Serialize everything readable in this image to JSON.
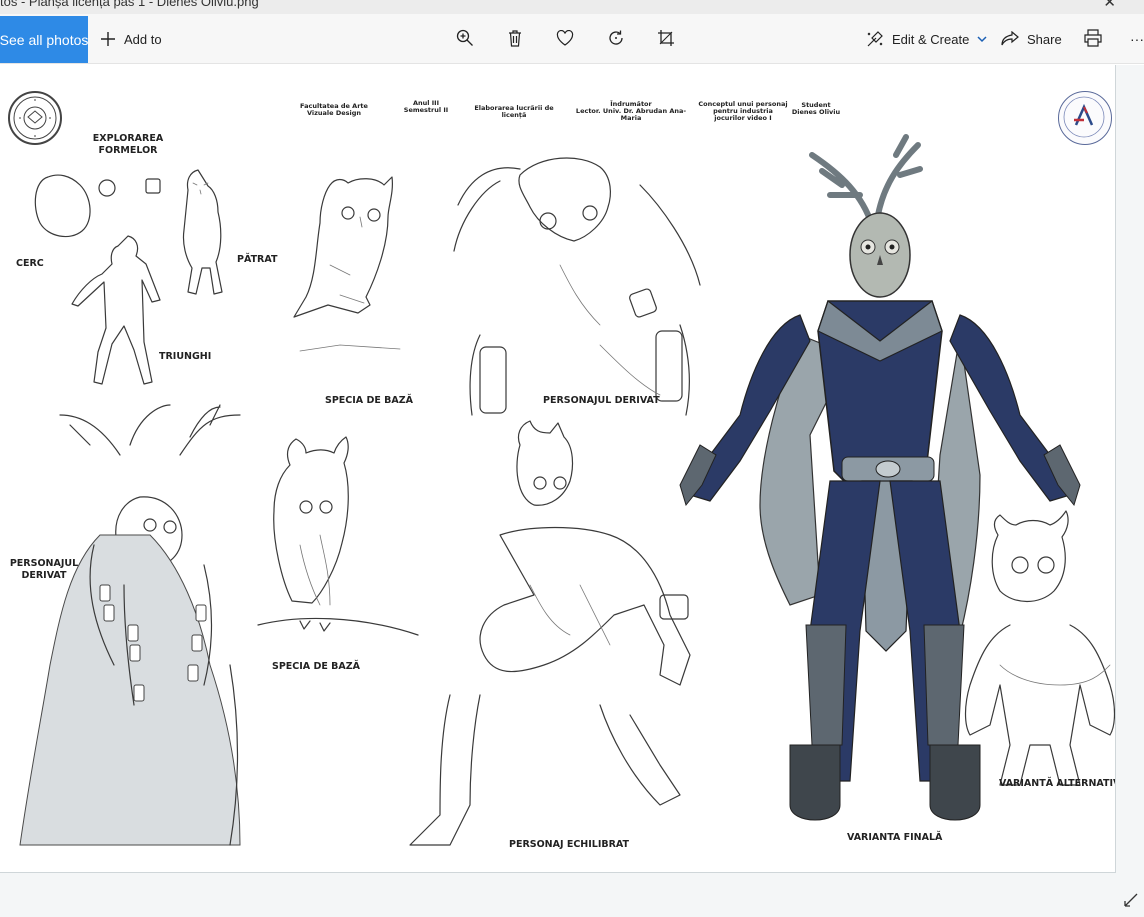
{
  "window": {
    "title": "tos - Planșă licență pas 1 - Dienes Olivlu.png",
    "close_glyph": "✕"
  },
  "toolbar": {
    "see_all_photos": "See all photos",
    "add_to": "Add to",
    "edit_create": "Edit & Create",
    "share": "Share",
    "more": "···",
    "icons": [
      "zoom-icon",
      "delete-icon",
      "favorite-icon",
      "rotate-icon",
      "crop-icon",
      "print-icon"
    ]
  },
  "poster": {
    "header": {
      "faculty": "Facultatea de Arte Vizuale Design",
      "year": "Anul III Semestrul II",
      "work": "Elaborarea lucrării de licență",
      "advisor_title": "Îndrumător",
      "advisor": "Lector. Univ. Dr. Abrudan Ana-Maria",
      "concept": "Conceptul unui personaj pentru industria jocurilor video I",
      "student_title": "Student",
      "student": "Dienes Oliviu"
    },
    "labels": {
      "exploration": "EXPLORAREA FORMELOR",
      "cerc": "CERC",
      "patrat": "PĂTRAT",
      "triunghi": "TRIUNGHI",
      "specia_top": "SPECIA DE BAZĂ",
      "personaj_derivat_top": "PERSONAJUL DERIVAT",
      "personaj_derivat_left": "PERSONAJUL DERIVAT",
      "specia_bottom": "SPECIA DE BAZĂ",
      "personaj_echilibrat": "PERSONAJ ECHILIBRAT",
      "varianta_finala": "VARIANTA FINALĂ",
      "varianta_alternativa": "VARIANTĂ ALTERNATIVĂ"
    }
  },
  "colors": {
    "accent": "#2e8ae6",
    "armor_navy": "#2b3a66",
    "armor_gray": "#8c99a3",
    "cape": "#9aa5ab"
  }
}
